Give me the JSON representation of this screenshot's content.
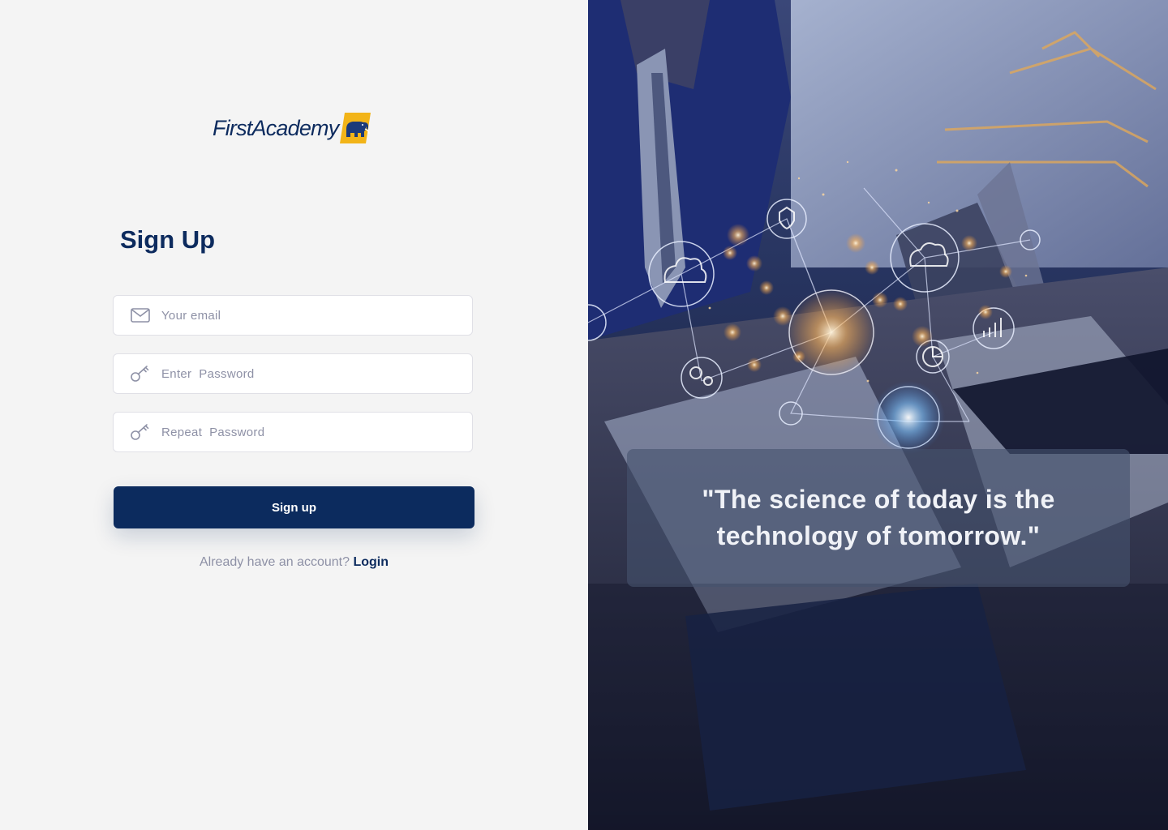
{
  "brand": {
    "name": "FirstAcademy",
    "primary_color": "#0c2b5e",
    "accent_color": "#f2b418",
    "logo_icon": "elephant-icon"
  },
  "signup": {
    "heading": "Sign Up",
    "email": {
      "icon": "envelope-icon",
      "placeholder": "Your email",
      "value": ""
    },
    "password": {
      "icon": "key-icon",
      "placeholder": "Enter  Password",
      "value": ""
    },
    "repeat_password": {
      "icon": "key-icon",
      "placeholder": "Repeat  Password",
      "value": ""
    },
    "submit_label": "Sign up",
    "account_prompt": "Already have an account?",
    "login_link": "Login"
  },
  "hero": {
    "quote": "\"The science of today is the technology of tomorrow.\""
  }
}
